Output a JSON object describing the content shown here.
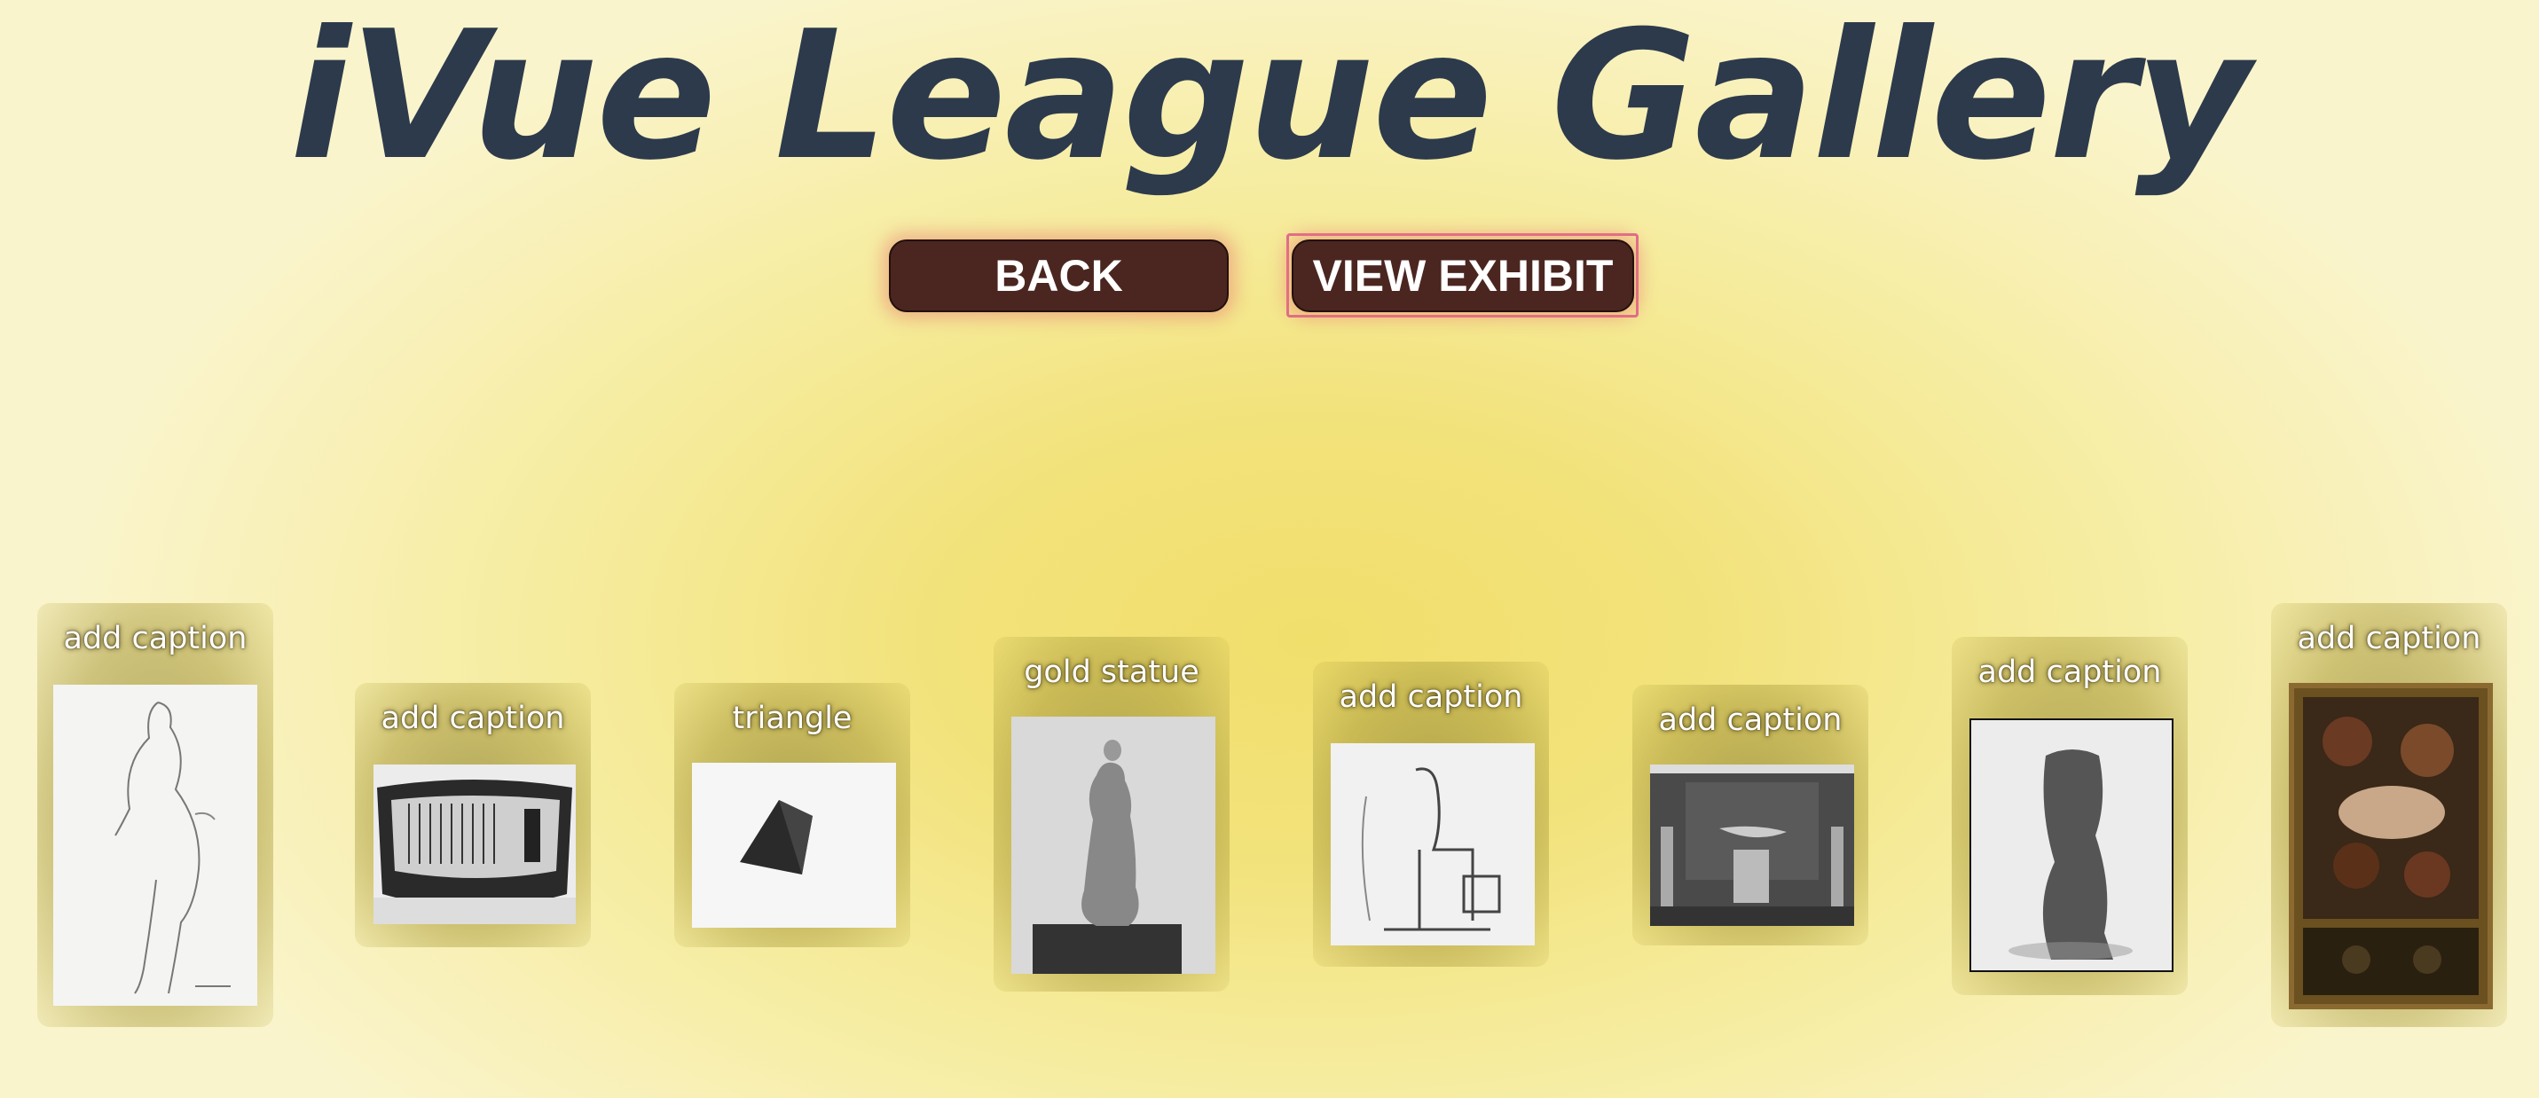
{
  "header": {
    "title": "iVue League Gallery"
  },
  "toolbar": {
    "back_label": "BACK",
    "view_exhibit_label": "VIEW EXHIBIT"
  },
  "gallery": {
    "items": [
      {
        "caption": "add caption",
        "image": "figure-sketch"
      },
      {
        "caption": "add caption",
        "image": "loom-vase"
      },
      {
        "caption": "triangle",
        "image": "pyramid-object"
      },
      {
        "caption": "gold statue",
        "image": "woman-statue"
      },
      {
        "caption": "add caption",
        "image": "seated-figure-sketch"
      },
      {
        "caption": "add caption",
        "image": "gallery-room"
      },
      {
        "caption": "add caption",
        "image": "torso-sculpture"
      },
      {
        "caption": "add caption",
        "image": "framed-painting"
      }
    ]
  },
  "colors": {
    "title": "#2c3a4c",
    "button_bg": "#4b2620",
    "focus_ring": "#e06c8c"
  }
}
